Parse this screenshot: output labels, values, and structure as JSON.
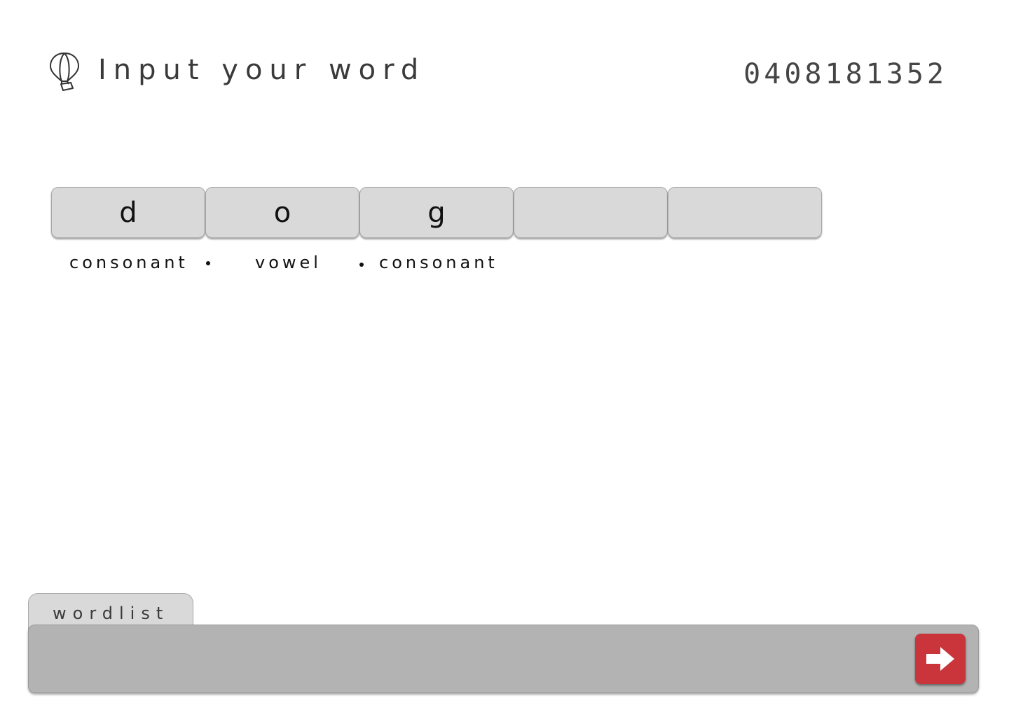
{
  "header": {
    "title": "Input your word",
    "code": "0408181352",
    "logo_icon": "hot-air-balloon-icon"
  },
  "word": {
    "slots": [
      {
        "letter": "d"
      },
      {
        "letter": "o"
      },
      {
        "letter": "g"
      },
      {
        "letter": ""
      },
      {
        "letter": ""
      }
    ],
    "labels": [
      "consonant",
      "vowel",
      "consonant"
    ]
  },
  "footer": {
    "tab_label": "wordlist",
    "submit_icon": "arrow-right-icon"
  },
  "colors": {
    "slot_bg": "#d9d9d9",
    "bar_bg": "#b3b3b3",
    "submit_bg": "#c9353a"
  }
}
